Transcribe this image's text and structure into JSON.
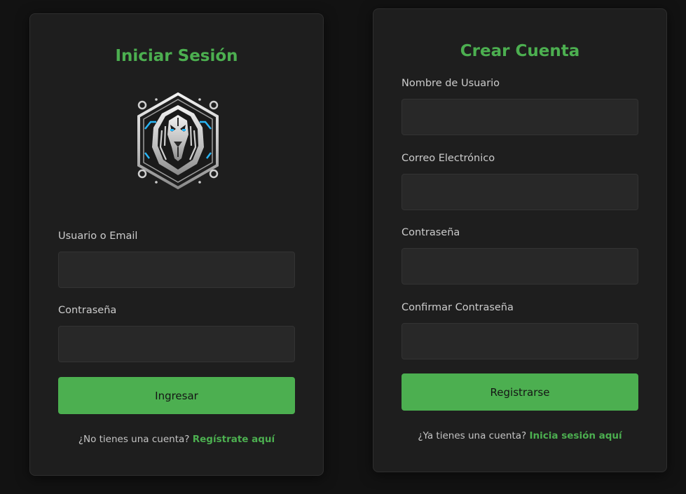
{
  "login": {
    "title": "Iniciar Sesión",
    "user_label": "Usuario o Email",
    "user_value": "",
    "password_label": "Contraseña",
    "password_value": "",
    "submit_label": "Ingresar",
    "footer_text": "¿No tienes una cuenta?",
    "footer_link": "Regístrate aquí",
    "logo_icon": "lion-logo-icon"
  },
  "register": {
    "title": "Crear Cuenta",
    "username_label": "Nombre de Usuario",
    "email_label": "Correo Electrónico",
    "password_label": "Contraseña",
    "confirm_label": "Confirmar Contraseña",
    "submit_label": "Registrarse",
    "footer_text": "¿Ya tienes una cuenta?",
    "footer_link": "Inicia sesión aquí"
  },
  "colors": {
    "background": "#121212",
    "card": "#1e1e1e",
    "accent": "#4caf50",
    "input": "#282828",
    "logo_highlight": "#29b6f6"
  }
}
